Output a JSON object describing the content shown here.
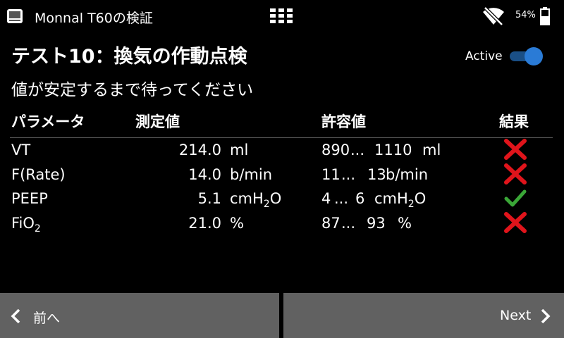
{
  "statusbar": {
    "app_title": "Monnal T60の検証",
    "battery": "54%"
  },
  "header": {
    "title": "テスト10：換気の作動点検",
    "instruction": "値が安定するまで待ってください",
    "active_label": "Active",
    "active_on": true
  },
  "table": {
    "headers": {
      "param": "パラメータ",
      "measured": "測定値",
      "range": "許容値",
      "result": "結果"
    },
    "rows": [
      {
        "param": "VT",
        "value": "214.0",
        "unit": "ml",
        "range_min": "890",
        "range_sep": "...",
        "range_max": "1110",
        "range_unit": "ml",
        "result": "fail"
      },
      {
        "param": "F(Rate)",
        "value": "14.0",
        "unit": "b/min",
        "range_min": "11",
        "range_sep": "...",
        "range_max": "13",
        "range_unit": "b/min",
        "result": "fail"
      },
      {
        "param": "PEEP",
        "value": "5.1",
        "unit_pre": "cmH",
        "unit_sub": "2",
        "unit_post": "O",
        "range_min": "4",
        "range_sep": "...",
        "range_max": "6",
        "range_unit_pre": "cmH",
        "range_unit_sub": "2",
        "range_unit_post": "O",
        "result": "pass"
      },
      {
        "param_pre": "FiO",
        "param_sub": "2",
        "value": "21.0",
        "unit": "%",
        "range_min": "87",
        "range_sep": "...",
        "range_max": "93",
        "range_unit": "%",
        "result": "fail"
      }
    ]
  },
  "footer": {
    "prev_label": "前へ",
    "next_label": "Next"
  },
  "colors": {
    "fail": "#e0141b",
    "pass": "#3aa637",
    "toggle": "#2a7bd6",
    "footer": "#616161"
  }
}
